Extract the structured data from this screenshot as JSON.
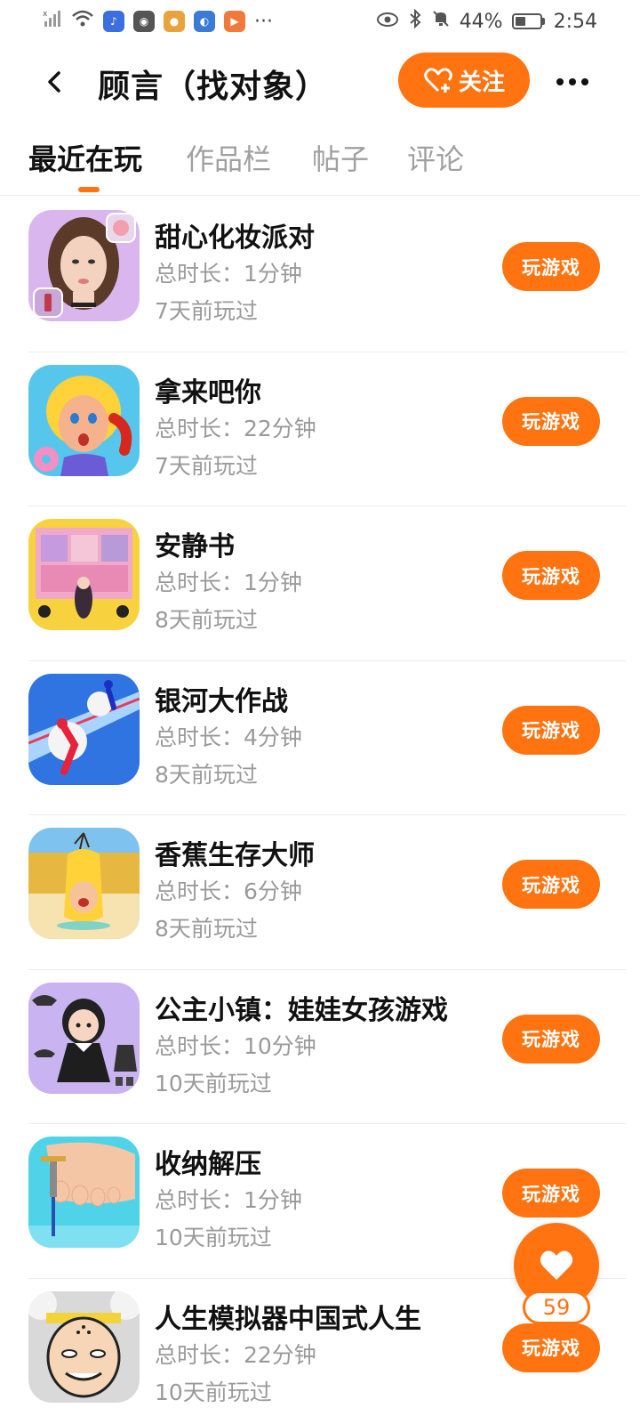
{
  "status_bar": {
    "battery": "44%",
    "time": "2:54",
    "more": "···",
    "left_icons": [
      "signal-off-icon",
      "wifi-icon",
      "music-app-icon",
      "wechat-icon",
      "photos-app-icon",
      "browser-app-icon",
      "video-app-icon"
    ],
    "right_icons": [
      "eye-icon",
      "bluetooth-icon",
      "mute-icon"
    ]
  },
  "header": {
    "title": "顾言（找对象）",
    "follow_label": "关注"
  },
  "tabs": [
    {
      "label": "最近在玩",
      "active": true
    },
    {
      "label": "作品栏",
      "active": false
    },
    {
      "label": "帖子",
      "active": false
    },
    {
      "label": "评论",
      "active": false
    }
  ],
  "games": [
    {
      "name": "甜心化妆派对",
      "duration": "总时长：1分钟",
      "last_played": "7天前玩过",
      "button": "玩游戏",
      "icon": "makeup-girl-icon"
    },
    {
      "name": "拿来吧你",
      "duration": "总时长：22分钟",
      "last_played": "7天前玩过",
      "button": "玩游戏",
      "icon": "cartoon-girl-icon"
    },
    {
      "name": "安静书",
      "duration": "总时长：1分钟",
      "last_played": "8天前玩过",
      "button": "玩游戏",
      "icon": "quiet-book-icon"
    },
    {
      "name": "银河大作战",
      "duration": "总时长：4分钟",
      "last_played": "8天前玩过",
      "button": "玩游戏",
      "icon": "runner-race-icon"
    },
    {
      "name": "香蕉生存大师",
      "duration": "总时长：6分钟",
      "last_played": "8天前玩过",
      "button": "玩游戏",
      "icon": "banana-kid-icon"
    },
    {
      "name": "公主小镇：娃娃女孩游戏",
      "duration": "总时长：10分钟",
      "last_played": "10天前玩过",
      "button": "玩游戏",
      "icon": "doll-dressup-icon"
    },
    {
      "name": "收纳解压",
      "duration": "总时长：1分钟",
      "last_played": "10天前玩过",
      "button": "玩游戏",
      "icon": "foot-care-icon"
    },
    {
      "name": "人生模拟器中国式人生",
      "duration": "总时长：22分钟",
      "last_played": "10天前玩过",
      "button": "玩游戏",
      "icon": "old-man-icon"
    }
  ],
  "like": {
    "count": "59"
  },
  "colors": {
    "accent": "#ff7411",
    "text_primary": "#111111",
    "text_secondary": "#9a9a9a"
  }
}
